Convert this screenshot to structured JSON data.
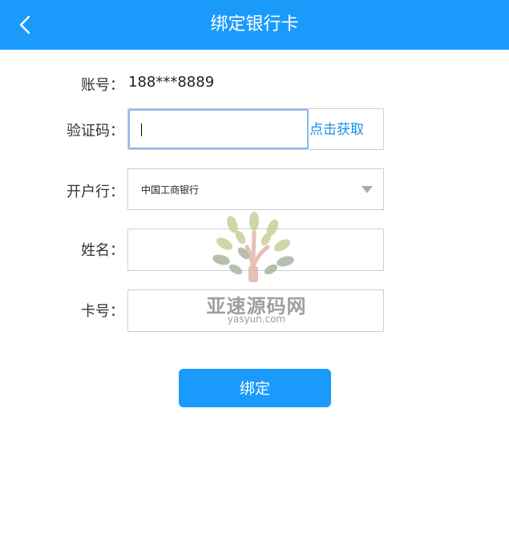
{
  "header": {
    "title": "绑定银行卡",
    "back_icon": "chevron-left-icon",
    "background": "#1a9bfc"
  },
  "form": {
    "account": {
      "label": "账号：",
      "value": "188***8889"
    },
    "code": {
      "label": "验证码：",
      "value": "",
      "get_code_label": "点击获取"
    },
    "bank": {
      "label": "开户行：",
      "selected": "中国工商银行"
    },
    "name": {
      "label": "姓名：",
      "value": ""
    },
    "card": {
      "label": "卡号：",
      "value": ""
    }
  },
  "submit": {
    "label": "绑定"
  },
  "watermark": {
    "main": "亚速源码网",
    "sub": "yasyun.com"
  },
  "colors": {
    "accent": "#1a9bfc",
    "link": "#1a8ee6",
    "border": "#cfcfcf",
    "focus_border": "#8ab8ec"
  }
}
